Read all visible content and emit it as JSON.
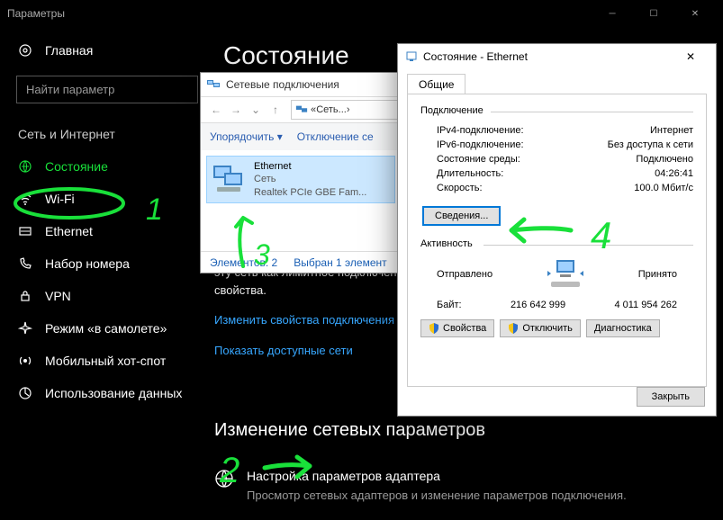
{
  "settings": {
    "window_title": "Параметры",
    "home": "Главная",
    "search_placeholder": "Найти параметр",
    "section": "Сеть и Интернет",
    "nav": {
      "status": "Состояние",
      "wifi": "Wi-Fi",
      "ethernet": "Ethernet",
      "dialup": "Набор номера",
      "vpn": "VPN",
      "airplane": "Режим «в самолете»",
      "hotspot": "Мобильный хот-спот",
      "datausage": "Использование данных"
    },
    "main_title": "Состояние",
    "partial_text1": "эту сеть как лимитное подключение или изменить другие",
    "partial_text2": "свойства.",
    "link_change_props": "Изменить свойства подключения",
    "link_show_networks": "Показать доступные сети",
    "change_section": "Изменение сетевых параметров",
    "adapter_settings_title": "Настройка параметров адаптера",
    "adapter_settings_desc": "Просмотр сетевых адаптеров и изменение параметров подключения."
  },
  "netconn": {
    "title": "Сетевые подключения",
    "breadcrumb1": "Сеть...",
    "sort_label": "Упорядочить",
    "disable_label": "Отключение се",
    "adapter": {
      "name": "Ethernet",
      "type": "Сеть",
      "device": "Realtek PCIe GBE Fam..."
    },
    "status_elements": "Элементов: 2",
    "status_selected": "Выбран 1 элемент"
  },
  "eth": {
    "title": "Состояние - Ethernet",
    "tab_general": "Общие",
    "section_connection": "Подключение",
    "rows": {
      "ipv4_label": "IPv4-подключение:",
      "ipv4_value": "Интернет",
      "ipv6_label": "IPv6-подключение:",
      "ipv6_value": "Без доступа к сети",
      "media_label": "Состояние среды:",
      "media_value": "Подключено",
      "duration_label": "Длительность:",
      "duration_value": "04:26:41",
      "speed_label": "Скорость:",
      "speed_value": "100.0 Мбит/с"
    },
    "details_btn": "Сведения...",
    "section_activity": "Активность",
    "sent_label": "Отправлено",
    "received_label": "Принято",
    "bytes_label": "Байт:",
    "bytes_sent": "216 642 999",
    "bytes_received": "4 011 954 262",
    "btn_properties": "Свойства",
    "btn_disable": "Отключить",
    "btn_diagnose": "Диагностика",
    "btn_close": "Закрыть"
  },
  "annotations": {
    "n1": "1",
    "n2": "2",
    "n3": "3",
    "n4": "4"
  }
}
